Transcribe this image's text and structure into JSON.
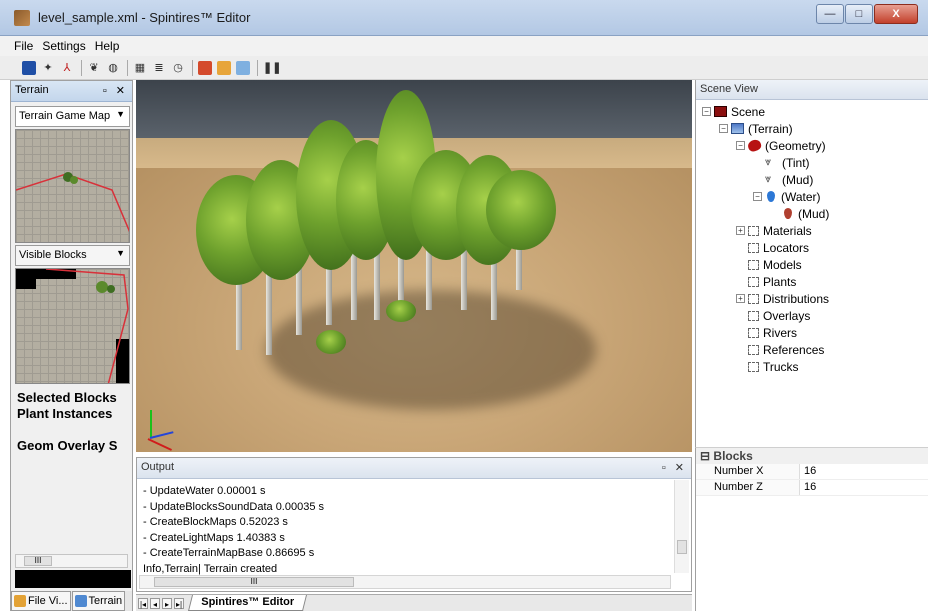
{
  "window": {
    "title": "level_sample.xml - Spintires™ Editor",
    "minimize": "—",
    "maximize": "□",
    "close": "X"
  },
  "menu": [
    "File",
    "Settings",
    "Help"
  ],
  "toolbar_icons": [
    "save-icon",
    "pointer-icon",
    "axis-icon",
    "plant-icon",
    "brush-icon",
    "grid-icon",
    "list-icon",
    "clock-icon",
    "texture-icon",
    "layers-icon",
    "copy-icon",
    "pause-icon"
  ],
  "terrain_panel": {
    "title": "Terrain",
    "controls": "▫ ✕",
    "map_dropdown": "Terrain Game Map",
    "blocks_dropdown": "Visible Blocks",
    "properties": [
      "Selected Blocks",
      "Plant Instances",
      "",
      "Geom Overlay S"
    ],
    "scroll_thumb": "III",
    "tabs": [
      "File Vi...",
      "Terrain"
    ]
  },
  "scene_view": {
    "title": "Scene View",
    "tree": [
      {
        "label": "Scene",
        "icon": "scene-icon",
        "exp": "−",
        "indent": 0
      },
      {
        "label": "(Terrain)",
        "icon": "terrain-icon",
        "exp": "−",
        "indent": 1
      },
      {
        "label": "(Geometry)",
        "icon": "geometry-icon",
        "exp": "−",
        "indent": 2
      },
      {
        "label": "(Tint)",
        "icon": "tint-icon",
        "exp": "",
        "indent": 3
      },
      {
        "label": "(Mud)",
        "icon": "mud-icon",
        "exp": "",
        "indent": 3
      },
      {
        "label": "(Water)",
        "icon": "water-icon",
        "exp": "−",
        "indent": 3
      },
      {
        "label": "(Mud)",
        "icon": "mud-drop-icon",
        "exp": "",
        "indent": 4
      },
      {
        "label": "Materials",
        "icon": "folder-icon",
        "exp": "+",
        "indent": 2
      },
      {
        "label": "Locators",
        "icon": "folder-icon",
        "exp": "",
        "indent": 2
      },
      {
        "label": "Models",
        "icon": "folder-icon",
        "exp": "",
        "indent": 2
      },
      {
        "label": "Plants",
        "icon": "folder-icon",
        "exp": "",
        "indent": 2
      },
      {
        "label": "Distributions",
        "icon": "folder-icon",
        "exp": "+",
        "indent": 2
      },
      {
        "label": "Overlays",
        "icon": "folder-icon",
        "exp": "",
        "indent": 2
      },
      {
        "label": "Rivers",
        "icon": "folder-icon",
        "exp": "",
        "indent": 2
      },
      {
        "label": "References",
        "icon": "folder-icon",
        "exp": "",
        "indent": 2
      },
      {
        "label": "Trucks",
        "icon": "folder-icon",
        "exp": "",
        "indent": 2
      }
    ]
  },
  "blocks_props": {
    "section": "Blocks",
    "collapse": "⊟",
    "rows": [
      {
        "key": "Number X",
        "value": "16"
      },
      {
        "key": "Number Z",
        "value": "16"
      }
    ]
  },
  "output": {
    "title": "Output",
    "controls": "▫ ✕",
    "lines": [
      "- UpdateWater 0.00001 s",
      "- UpdateBlocksSoundData 0.00035 s",
      "- CreateBlockMaps 0.52023 s",
      "- CreateLightMaps 1.40383 s",
      "- CreateTerrainMapBase 0.86695 s",
      "Info,Terrain| Terrain created"
    ],
    "scroll_thumb": "III"
  },
  "sheet_tabs": {
    "nav": [
      "|◂",
      "◂",
      "▸",
      "▸|"
    ],
    "active": "Spintires™ Editor"
  }
}
